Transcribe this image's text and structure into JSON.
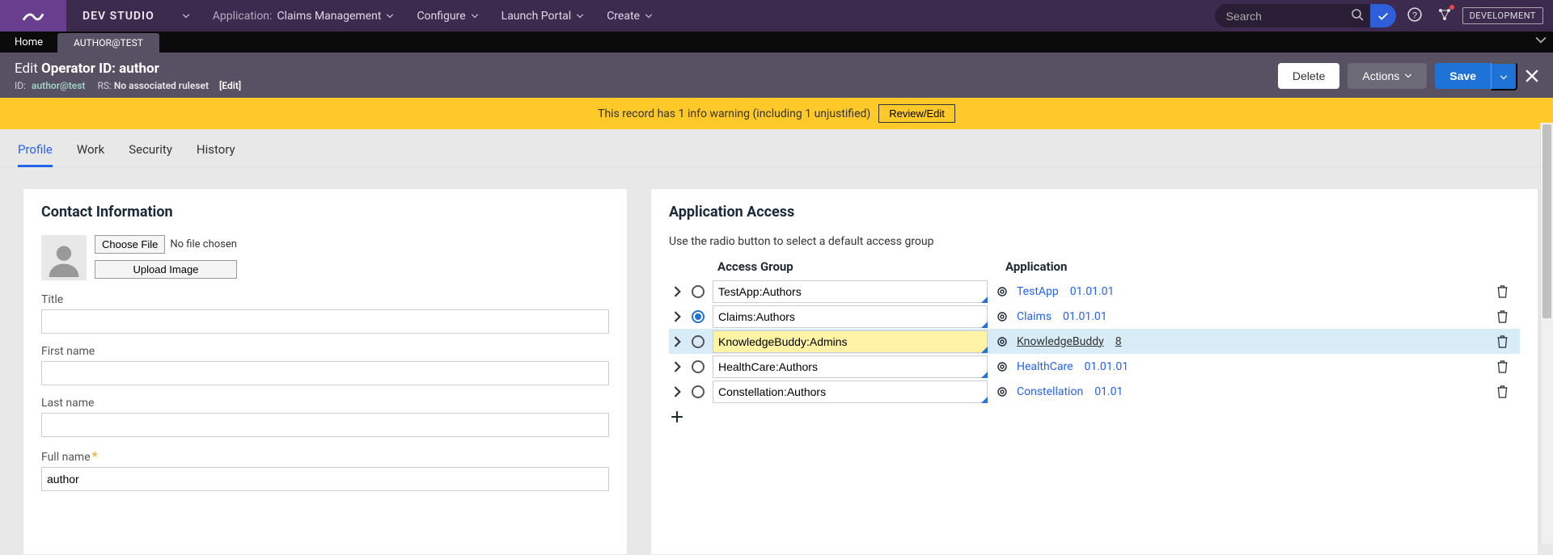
{
  "topbar": {
    "brand": "DEV STUDIO",
    "app_label": "Application:",
    "app_name": "Claims Management",
    "menu_configure": "Configure",
    "menu_launch": "Launch Portal",
    "menu_create": "Create",
    "search_placeholder": "Search",
    "env_badge": "DEVELOPMENT"
  },
  "tabs": {
    "home": "Home",
    "active": "AUTHOR@TEST"
  },
  "ruleform": {
    "edit": "Edit",
    "type": "Operator ID:",
    "name": "author",
    "id_label": "ID:",
    "id_val": "author@test",
    "rs_label": "RS:",
    "rs_val": "No associated ruleset",
    "editlink": "[Edit]",
    "delete": "Delete",
    "actions": "Actions",
    "save": "Save"
  },
  "warn": {
    "msg": "This record has 1 info warning (including 1 unjustified)",
    "btn": "Review/Edit"
  },
  "tabs2": {
    "items": [
      {
        "label": "Profile",
        "active": true
      },
      {
        "label": "Work"
      },
      {
        "label": "Security"
      },
      {
        "label": "History"
      }
    ]
  },
  "contact": {
    "heading": "Contact Information",
    "choose": "Choose File",
    "nofile": "No file chosen",
    "upload": "Upload Image",
    "title_lbl": "Title",
    "first_lbl": "First name",
    "last_lbl": "Last name",
    "full_lbl": "Full name",
    "full_val": "author"
  },
  "access": {
    "heading": "Application Access",
    "help": "Use the radio button to select a default access group",
    "col_group": "Access Group",
    "col_app": "Application",
    "rows": [
      {
        "group": "TestApp:Authors",
        "app": "TestApp",
        "ver": "01.01.01",
        "checked": false,
        "hl": false
      },
      {
        "group": "Claims:Authors",
        "app": "Claims",
        "ver": "01.01.01",
        "checked": true,
        "hl": false
      },
      {
        "group": "KnowledgeBuddy:Admins",
        "app": "KnowledgeBuddy",
        "ver": "8",
        "checked": false,
        "hl": true
      },
      {
        "group": "HealthCare:Authors",
        "app": "HealthCare",
        "ver": "01.01.01",
        "checked": false,
        "hl": false
      },
      {
        "group": "Constellation:Authors",
        "app": "Constellation",
        "ver": "01.01",
        "checked": false,
        "hl": false
      }
    ]
  }
}
